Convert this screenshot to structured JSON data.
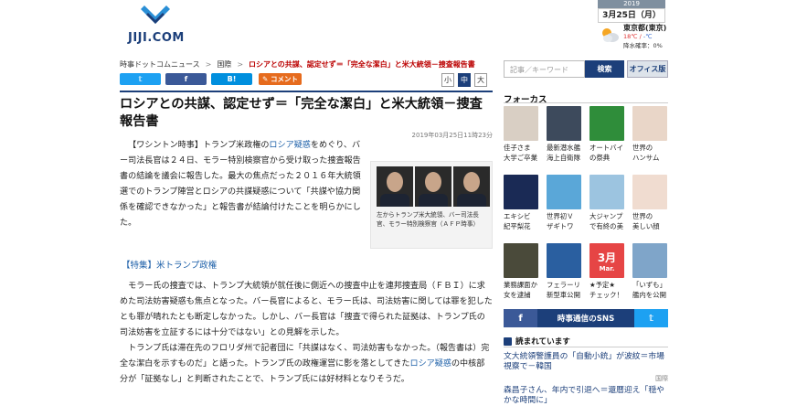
{
  "site": {
    "logo_text": "JIJI.COM"
  },
  "date": {
    "year": "2019",
    "date": "3月25日（月）"
  },
  "weather": {
    "city": "東京都(東京)",
    "high": "18℃",
    "low": "-℃",
    "rain_label": "降水確率：",
    "rain": "0%"
  },
  "breadcrumb": {
    "home": "時事ドットコムニュース",
    "sep": ">",
    "section": "国際",
    "current": "ロシアとの共謀、認定せず＝「完全な潔白」と米大統領－捜査報告書"
  },
  "share": {
    "twitter": "𝕥",
    "facebook": "f",
    "hatena": "B!",
    "comment": "コメント"
  },
  "font_size": {
    "small": "小",
    "medium": "中",
    "large": "大"
  },
  "article": {
    "title": "ロシアとの共謀、認定せず＝「完全な潔白」と米大統領－捜査報告書",
    "timestamp": "2019年03月25日11時23分",
    "para1_a": "【ワシントン時事】トランプ米政権の",
    "para1_link": "ロシア疑惑",
    "para1_b": "をめぐり、バー司法長官は２４日、モラー特別検察官から受け取った捜査報告書の結論を議会に報告した。最大の焦点だった２０１６年大統領選でのトランプ陣営とロシアの共謀疑惑について「共謀や協力関係を確認できなかった」と報告書が結論付けたことを明らかにした。",
    "photo_caption": "左からトランプ米大統領、バー司法長官、モラー特別検察官（ＡＦＰ時事）",
    "feature": "【特集】米トランプ政権",
    "para2": "モラー氏の捜査では、トランプ大統領が就任後に側近への捜査中止を連邦捜査局（ＦＢＩ）に求めた司法妨害疑惑も焦点となった。バー長官によると、モラー氏は、司法妨害に関しては罪を犯したとも罪が晴れたとも断定しなかった。しかし、バー長官は「捜査で得られた証拠は、トランプ氏の司法妨害を立証するには十分ではない」との見解を示した。",
    "para3_a": "トランプ氏は滞在先のフロリダ州で記者団に「共謀はなく、司法妨害もなかった。（報告書は）完全な潔白を示すものだ」と語った。トランプ氏の政権運営に影を落としてきた",
    "para3_link": "ロシア疑惑",
    "para3_b": "の中核部分が「証拠なし」と判断されたことで、トランプ氏には好材料となりそうだ。"
  },
  "search": {
    "placeholder": "記事／キーワード",
    "button": "検索",
    "office": "オフィス版"
  },
  "focus": {
    "heading": "フォーカス",
    "tiles": [
      {
        "label": "佳子さま",
        "label2": "大学ご卒業",
        "color": "#d9cfc4"
      },
      {
        "label": "最新潜水艦",
        "label2": "海上自衛隊",
        "color": "#3d4a5c"
      },
      {
        "label": "オートバイ",
        "label2": "の祭典",
        "color": "#2f8d3a"
      },
      {
        "label": "世界の",
        "label2": "ハンサム",
        "color": "#e9d6c8"
      },
      {
        "label": "エキシビ",
        "label2": "紀平梨花",
        "color": "#1a2a55"
      },
      {
        "label": "世界初Ｖ",
        "label2": "ザギトワ",
        "color": "#5aa7d8"
      },
      {
        "label": "大ジャンプ",
        "label2": "で有終の美",
        "color": "#9cc4e0"
      },
      {
        "label": "世界の",
        "label2": "美しい顔",
        "color": "#f0dcd0"
      },
      {
        "label": "業務課面か",
        "label2": "女を逮捕",
        "color": "#4a4a3a"
      },
      {
        "label": "フェラーリ",
        "label2": "新型車公開",
        "color": "#2a5fa0"
      },
      {
        "label": "★予定★",
        "label2": "チェック！",
        "color": "#e64545"
      },
      {
        "label": "「いずも」",
        "label2": "艦内を公開",
        "color": "#7fa5c9"
      }
    ],
    "calendar_month": "3月",
    "calendar_sub": "Mar."
  },
  "sns": {
    "facebook": "f",
    "center": "時事通信のSNS",
    "twitter": "𝕥"
  },
  "reading": {
    "heading": "読まれています",
    "items": [
      {
        "title": "文大統領警護員の「自動小銃」が波紋＝市場視察で－韓国",
        "category": "国際"
      },
      {
        "title": "森昌子さん、年内で引退へ＝還暦迎え「穏やかな時間に」"
      }
    ]
  }
}
